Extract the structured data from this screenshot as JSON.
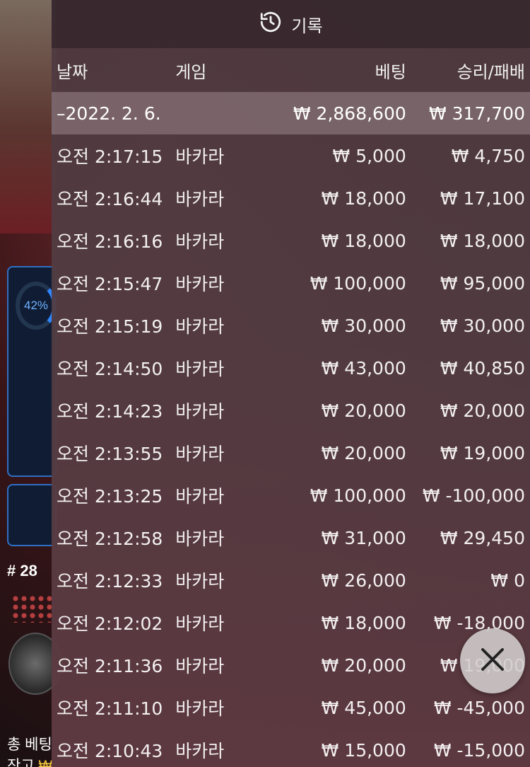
{
  "background": {
    "gauge_text": "42%",
    "round_label": "# 28",
    "footer_line1": "총 베팅",
    "footer_line2": "잔고"
  },
  "header": {
    "title": "기록",
    "icon": "history-icon"
  },
  "columns": {
    "date": "날짜",
    "game": "게임",
    "bet": "베팅",
    "result": "승리/패배"
  },
  "currency_symbol": "₩",
  "date_group": {
    "label": "–2022. 2. 6.",
    "total_bet": "₩ 2,868,600",
    "total_result": "₩ 317,700"
  },
  "rows": [
    {
      "time": "오전 2:17:15",
      "game": "바카라",
      "bet": "₩ 5,000",
      "result": "₩ 4,750"
    },
    {
      "time": "오전 2:16:44",
      "game": "바카라",
      "bet": "₩ 18,000",
      "result": "₩ 17,100"
    },
    {
      "time": "오전 2:16:16",
      "game": "바카라",
      "bet": "₩ 18,000",
      "result": "₩ 18,000"
    },
    {
      "time": "오전 2:15:47",
      "game": "바카라",
      "bet": "₩ 100,000",
      "result": "₩ 95,000"
    },
    {
      "time": "오전 2:15:19",
      "game": "바카라",
      "bet": "₩ 30,000",
      "result": "₩ 30,000"
    },
    {
      "time": "오전 2:14:50",
      "game": "바카라",
      "bet": "₩ 43,000",
      "result": "₩ 40,850"
    },
    {
      "time": "오전 2:14:23",
      "game": "바카라",
      "bet": "₩ 20,000",
      "result": "₩ 20,000"
    },
    {
      "time": "오전 2:13:55",
      "game": "바카라",
      "bet": "₩ 20,000",
      "result": "₩ 19,000"
    },
    {
      "time": "오전 2:13:25",
      "game": "바카라",
      "bet": "₩ 100,000",
      "result": "₩ -100,000"
    },
    {
      "time": "오전 2:12:58",
      "game": "바카라",
      "bet": "₩ 31,000",
      "result": "₩ 29,450"
    },
    {
      "time": "오전 2:12:33",
      "game": "바카라",
      "bet": "₩ 26,000",
      "result": "₩ 0"
    },
    {
      "time": "오전 2:12:02",
      "game": "바카라",
      "bet": "₩ 18,000",
      "result": "₩ -18,000"
    },
    {
      "time": "오전 2:11:36",
      "game": "바카라",
      "bet": "₩ 20,000",
      "result": "₩ 19,000"
    },
    {
      "time": "오전 2:11:10",
      "game": "바카라",
      "bet": "₩ 45,000",
      "result": "₩ -45,000"
    },
    {
      "time": "오전 2:10:43",
      "game": "바카라",
      "bet": "₩ 15,000",
      "result": "₩ -15,000"
    }
  ],
  "close_button": {
    "icon": "close-icon"
  },
  "colors": {
    "panel": "#4e3a40",
    "date_row": "#aa969c",
    "text": "#f3f0f1",
    "gauge": "#2f86ff",
    "balance": "#f2c53d"
  }
}
